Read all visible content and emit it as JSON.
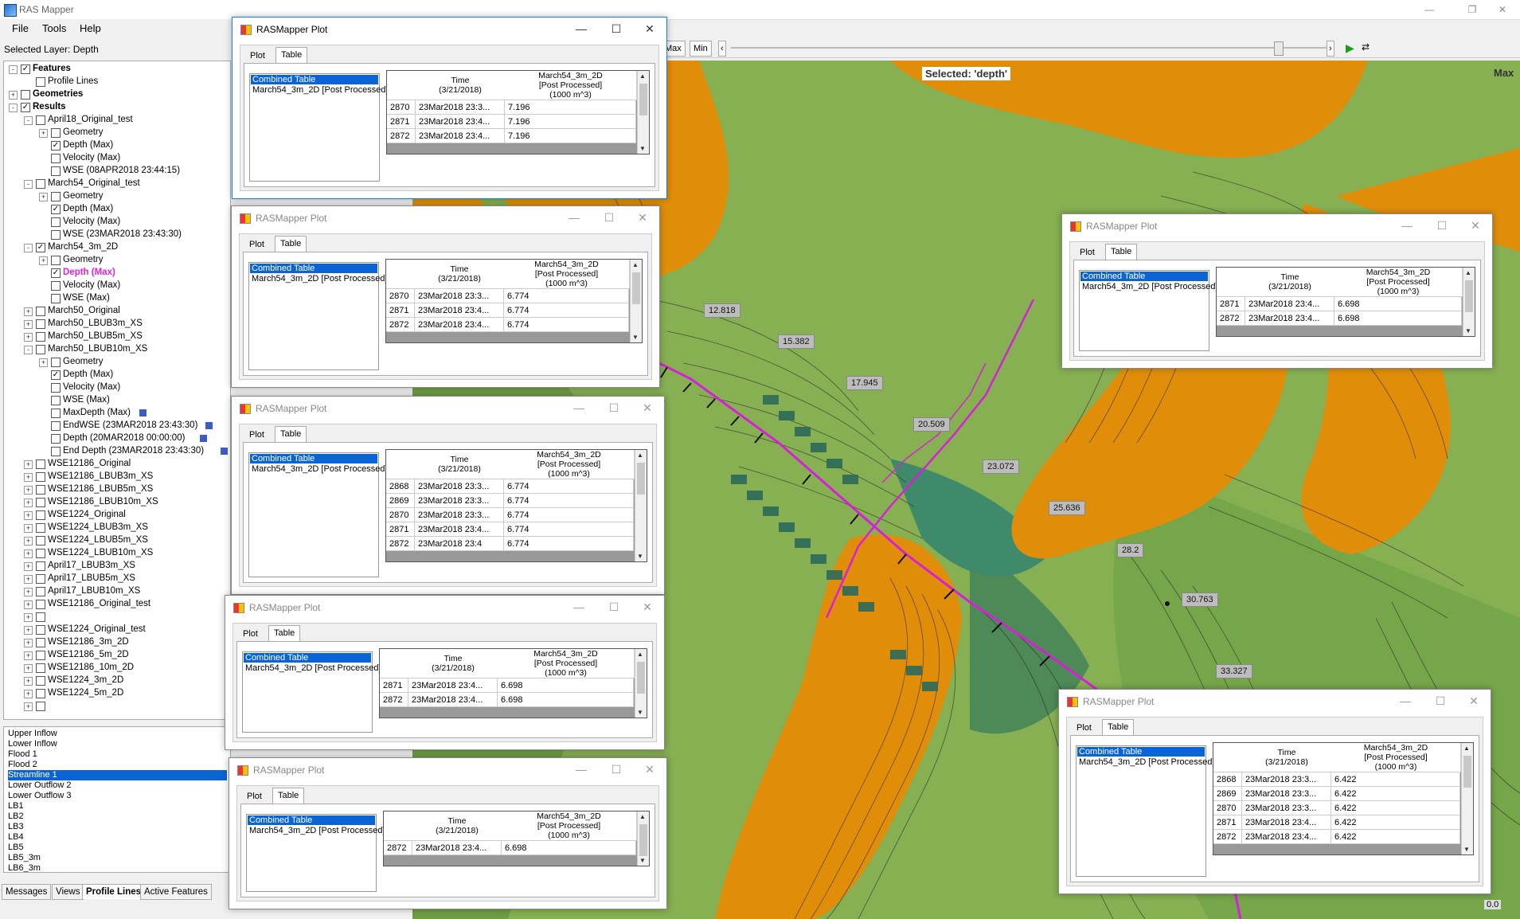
{
  "app": {
    "title": "RAS Mapper"
  },
  "menu": [
    "File",
    "Tools",
    "Help"
  ],
  "selected_layer": "Selected Layer: Depth",
  "tree": [
    {
      "label": "Features",
      "exp": "-",
      "checked": true,
      "bold": true
    },
    {
      "label": "Profile Lines",
      "checked": false
    },
    {
      "label": "Geometries",
      "exp": "+",
      "checked": false,
      "bold": true
    },
    {
      "label": "Results",
      "exp": "-",
      "checked": true,
      "bold": true
    },
    {
      "label": "April18_Original_test",
      "exp": "-",
      "checked": false
    },
    {
      "label": "Geometry",
      "exp": "+",
      "checked": false
    },
    {
      "label": "Depth (Max)",
      "checked": true
    },
    {
      "label": "Velocity (Max)",
      "checked": false
    },
    {
      "label": "WSE (08APR2018 23:44:15)",
      "checked": false
    },
    {
      "label": "March54_Original_test",
      "exp": "-",
      "checked": false
    },
    {
      "label": "Geometry",
      "exp": "+",
      "checked": false
    },
    {
      "label": "Depth (Max)",
      "checked": true
    },
    {
      "label": "Velocity (Max)",
      "checked": false
    },
    {
      "label": "WSE (23MAR2018 23:43:30)",
      "checked": false
    },
    {
      "label": "March54_3m_2D",
      "exp": "-",
      "checked": true
    },
    {
      "label": "Geometry",
      "exp": "+",
      "checked": false
    },
    {
      "label": "Depth (Max)",
      "checked": true,
      "magenta": true
    },
    {
      "label": "Velocity (Max)",
      "checked": false
    },
    {
      "label": "WSE (Max)",
      "checked": false
    },
    {
      "label": "March50_Original",
      "exp": "+",
      "checked": false
    },
    {
      "label": "March50_LBUB3m_XS",
      "exp": "+",
      "checked": false
    },
    {
      "label": "March50_LBUB5m_XS",
      "exp": "+",
      "checked": false
    },
    {
      "label": "March50_LBUB10m_XS",
      "exp": "-",
      "checked": false
    },
    {
      "label": "Geometry",
      "exp": "+",
      "checked": false
    },
    {
      "label": "Depth (Max)",
      "checked": true
    },
    {
      "label": "Velocity (Max)",
      "checked": false
    },
    {
      "label": "WSE (Max)",
      "checked": false
    },
    {
      "label": "MaxDepth (Max)",
      "checked": false,
      "tag": true
    },
    {
      "label": "EndWSE (23MAR2018 23:43:30)",
      "checked": false,
      "tag": true
    },
    {
      "label": "Depth (20MAR2018 00:00:00)",
      "checked": false,
      "tag": true
    },
    {
      "label": "End Depth (23MAR2018 23:43:30)",
      "checked": false,
      "tag": true
    },
    {
      "label": "WSE12186_Original",
      "exp": "+",
      "checked": false
    },
    {
      "label": "WSE12186_LBUB3m_XS",
      "exp": "+",
      "checked": false
    },
    {
      "label": "WSE12186_LBUB5m_XS",
      "exp": "+",
      "checked": false
    },
    {
      "label": "WSE12186_LBUB10m_XS",
      "exp": "+",
      "checked": false
    },
    {
      "label": "WSE1224_Original",
      "exp": "+",
      "checked": false
    },
    {
      "label": "WSE1224_LBUB3m_XS",
      "exp": "+",
      "checked": false
    },
    {
      "label": "WSE1224_LBUB5m_XS",
      "exp": "+",
      "checked": false
    },
    {
      "label": "WSE1224_LBUB10m_XS",
      "exp": "+",
      "checked": false
    },
    {
      "label": "April17_LBUB3m_XS",
      "exp": "+",
      "checked": false
    },
    {
      "label": "April17_LBUB5m_XS",
      "exp": "+",
      "checked": false
    },
    {
      "label": "April17_LBUB10m_XS",
      "exp": "+",
      "checked": false
    },
    {
      "label": "WSE12186_Original_test",
      "exp": "+",
      "checked": false
    },
    {
      "label": "",
      "exp": "+",
      "checked": false
    },
    {
      "label": "WSE1224_Original_test",
      "exp": "+",
      "checked": false
    },
    {
      "label": "WSE12186_3m_2D",
      "exp": "+",
      "checked": false
    },
    {
      "label": "WSE12186_5m_2D",
      "exp": "+",
      "checked": false
    },
    {
      "label": "WSE12186_10m_2D",
      "exp": "+",
      "checked": false
    },
    {
      "label": "WSE1224_3m_2D",
      "exp": "+",
      "checked": false
    },
    {
      "label": "WSE1224_5m_2D",
      "exp": "+",
      "checked": false
    },
    {
      "label": "",
      "exp": "+",
      "checked": false
    }
  ],
  "profile_lines": [
    "Upper Inflow",
    "Lower Inflow",
    "Flood 1",
    "Flood 2",
    "Streamline 1",
    "Lower Outflow 2",
    "Lower Outflow 3",
    "LB1",
    "LB2",
    "LB3",
    "LB4",
    "LB5",
    "LB5_3m",
    "LB6_3m"
  ],
  "profile_selected": 4,
  "bottom_tabs": [
    "Messages",
    "Views",
    "Profile Lines",
    "Active Features"
  ],
  "toolbar": {
    "max": "Max",
    "min": "Min"
  },
  "map": {
    "selected_text": "Selected: 'depth'",
    "max_text": "Max",
    "labels": [
      "12.818",
      "15.382",
      "17.945",
      "20.509",
      "23.072",
      "25.636",
      "28.2",
      "30.763",
      "33.327"
    ],
    "corner_value": "0.0"
  },
  "windows": {
    "title": "RASMapper Plot",
    "tab_plot": "Plot",
    "tab_table": "Table",
    "list_items": [
      "Combined Table",
      "March54_3m_2D [Post Processed]"
    ],
    "col_time": "Time\n(3/21/2018)",
    "col_val": "March54_3m_2D\n[Post Processed]\n(1000 m^3)",
    "w1": [
      [
        "2870",
        "23Mar2018 23:3...",
        "7.196"
      ],
      [
        "2871",
        "23Mar2018 23:4...",
        "7.196"
      ],
      [
        "2872",
        "23Mar2018 23:4...",
        "7.196"
      ]
    ],
    "w2": [
      [
        "2870",
        "23Mar2018 23:3...",
        "6.774"
      ],
      [
        "2871",
        "23Mar2018 23:4...",
        "6.774"
      ],
      [
        "2872",
        "23Mar2018 23:4...",
        "6.774"
      ]
    ],
    "w3": [
      [
        "2868",
        "23Mar2018 23:3...",
        "6.774"
      ],
      [
        "2869",
        "23Mar2018 23:3...",
        "6.774"
      ],
      [
        "2870",
        "23Mar2018 23:3...",
        "6.774"
      ],
      [
        "2871",
        "23Mar2018 23:4...",
        "6.774"
      ],
      [
        "2872",
        "23Mar2018 23:4",
        "6.774"
      ]
    ],
    "w4": [
      [
        "2871",
        "23Mar2018 23:4...",
        "6.698"
      ],
      [
        "2872",
        "23Mar2018 23:4...",
        "6.698"
      ]
    ],
    "w5": [
      [
        "2872",
        "23Mar2018 23:4...",
        "6.698"
      ]
    ],
    "w6": [
      [
        "2871",
        "23Mar2018 23:4...",
        "6.698"
      ],
      [
        "2872",
        "23Mar2018 23:4...",
        "6.698"
      ]
    ],
    "w7": [
      [
        "2868",
        "23Mar2018 23:3...",
        "6.422"
      ],
      [
        "2869",
        "23Mar2018 23:3...",
        "6.422"
      ],
      [
        "2870",
        "23Mar2018 23:3...",
        "6.422"
      ],
      [
        "2871",
        "23Mar2018 23:4...",
        "6.422"
      ],
      [
        "2872",
        "23Mar2018 23:4...",
        "6.422"
      ]
    ]
  },
  "colors": {
    "selection": "#0a64d6",
    "magenta": "#e020e0",
    "terrain_orange": "#e08e0a",
    "terrain_green": "#7aa84a"
  }
}
